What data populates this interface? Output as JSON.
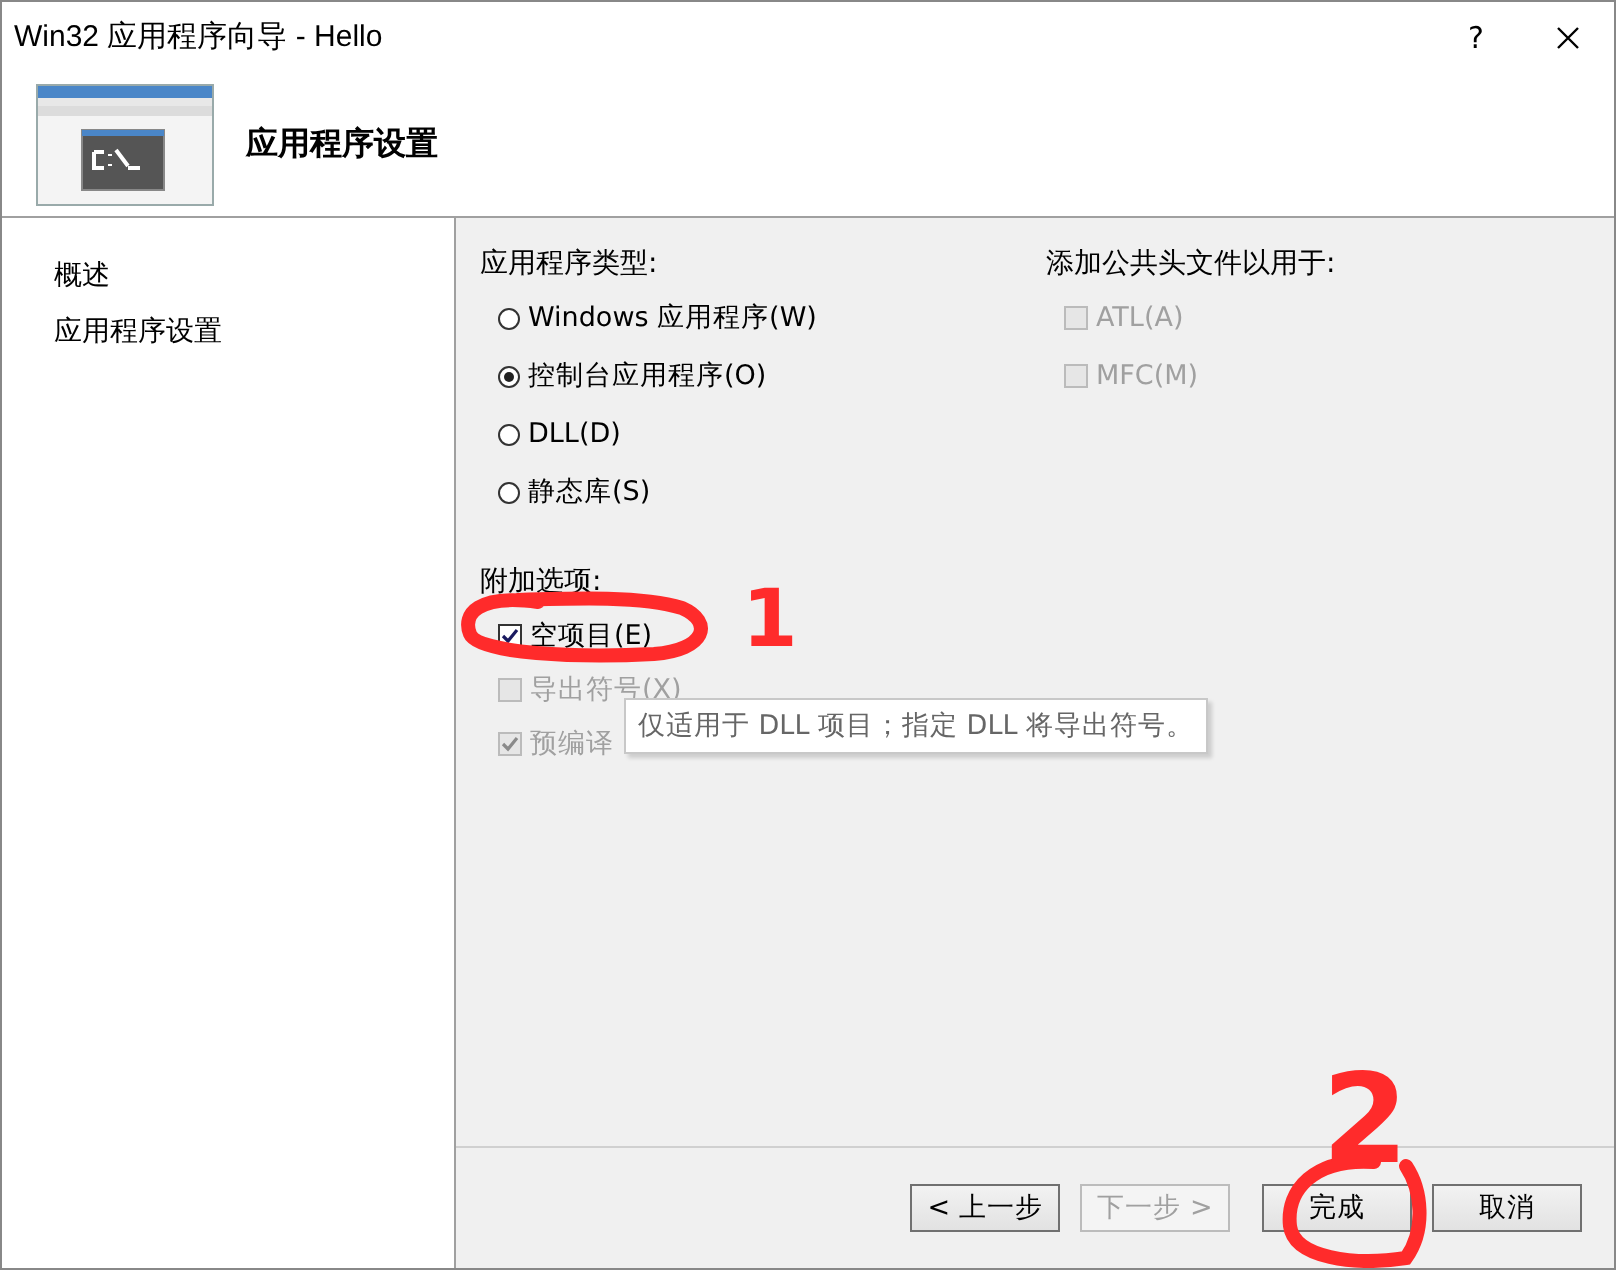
{
  "window": {
    "title": "Win32 应用程序向导 - Hello",
    "help": "?"
  },
  "header": {
    "title": "应用程序设置"
  },
  "sidebar": {
    "items": [
      {
        "label": "概述"
      },
      {
        "label": "应用程序设置"
      }
    ]
  },
  "app_type": {
    "label": "应用程序类型:",
    "options": [
      {
        "label": "Windows 应用程序(W)",
        "selected": false
      },
      {
        "label": "控制台应用程序(O)",
        "selected": true
      },
      {
        "label": "DLL(D)",
        "selected": false
      },
      {
        "label": "静态库(S)",
        "selected": false
      }
    ]
  },
  "headers": {
    "label": "添加公共头文件以用于:",
    "options": [
      {
        "label": "ATL(A)",
        "checked": false,
        "disabled": true
      },
      {
        "label": "MFC(M)",
        "checked": false,
        "disabled": true
      }
    ]
  },
  "extra": {
    "label": "附加选项:",
    "options": [
      {
        "label": "空项目(E)",
        "checked": true,
        "disabled": false
      },
      {
        "label": "导出符号(X)",
        "checked": false,
        "disabled": true
      },
      {
        "label": "预编译",
        "checked": true,
        "disabled": true
      }
    ]
  },
  "tooltip": "仅适用于 DLL 项目；指定 DLL 将导出符号。",
  "buttons": [
    {
      "label": "< 上一步",
      "disabled": false
    },
    {
      "label": "下一步 >",
      "disabled": true
    },
    {
      "label": "完成",
      "disabled": false
    },
    {
      "label": "取消",
      "disabled": false
    }
  ],
  "annotations": [
    {
      "label": "1"
    },
    {
      "label": "2"
    }
  ]
}
